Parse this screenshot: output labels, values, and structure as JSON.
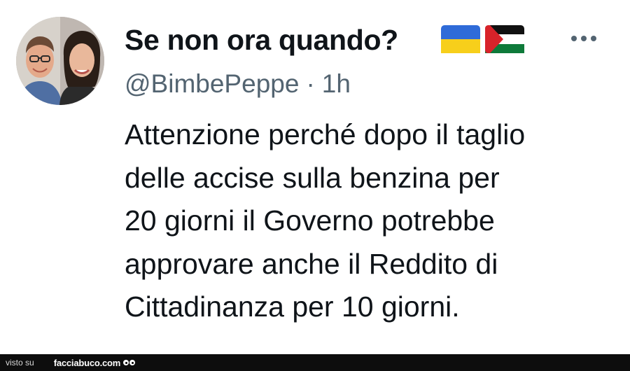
{
  "tweet": {
    "display_name": "Se non ora quando?",
    "handle": "@BimbePeppe",
    "separator": "·",
    "time": "1h",
    "text_lines": [
      "Attenzione perché dopo il taglio",
      "delle accise sulla benzina per",
      "20 giorni il Governo potrebbe",
      "approvare anche il Reddito di",
      "Cittadinanza per 10 giorni."
    ],
    "flags": [
      "ukraine-flag-icon",
      "palestine-flag-icon"
    ]
  },
  "footer": {
    "seen_on": "visto su",
    "site": "facciabuco.com"
  },
  "colors": {
    "text": "#0f1419",
    "secondary_text": "#536471",
    "footer_bg": "#0d0d0d",
    "ukraine_blue": "#2f6bd8",
    "ukraine_yellow": "#f7cf1b",
    "palestine_red": "#d8232a",
    "palestine_green": "#0e7a3a"
  }
}
